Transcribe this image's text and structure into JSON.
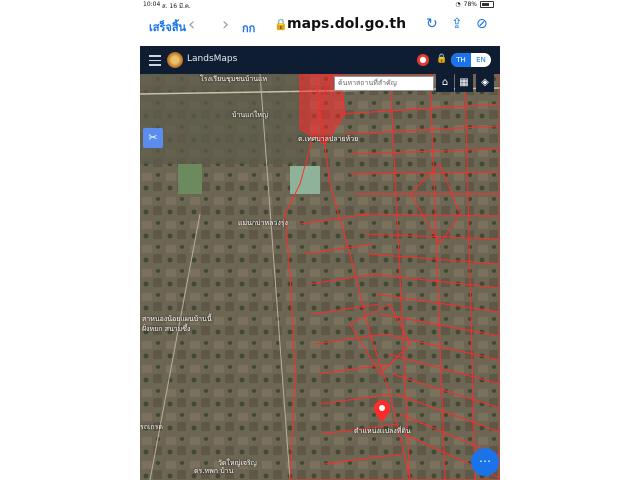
{
  "status": {
    "time": "10:04",
    "date": "ส. 16 มี.ค.",
    "battery": "78%"
  },
  "browser": {
    "done_label": "เสร็จสิ้น",
    "text_size": "กก",
    "url": "maps.dol.go.th"
  },
  "app": {
    "name": "LandsMaps",
    "lang_th": "TH",
    "lang_en": "EN"
  },
  "search": {
    "placeholder": "ค้นหาสถานที่สำคัญ"
  },
  "map_labels": [
    "โรงเรียนชุมชนบ้านแห",
    "บ้านแก่ใหญ่",
    "แม่นกบ่าหลวงรุ่ง",
    "สาหนองน้อยแผนบ้านนี้",
    "ฝั่งหยก สนามซึ้ง",
    "รถเกรด",
    "วัดใหญ่เจริญ",
    "ตร.หพก บ้าน",
    "ต.เทศบาลปลายห้วย",
    "ตำแหน่งเเปลงที่ดิน"
  ],
  "icons": {
    "hamburger": "menu-icon",
    "alert": "alert-icon",
    "lock": "lock-icon",
    "home": "home-icon",
    "grid": "grid-icon",
    "layers": "layers-icon",
    "tools": "tools-icon",
    "pin": "map-pin-icon",
    "more": "more-icon"
  },
  "colors": {
    "appbar": "#0f1d33",
    "accent": "#1a73e8",
    "parcel": "#ff2a2a"
  }
}
